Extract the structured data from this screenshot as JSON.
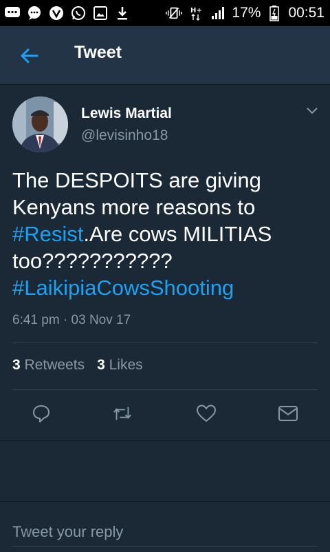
{
  "status_bar": {
    "battery": "17%",
    "time": "00:51",
    "network": "H+"
  },
  "app_bar": {
    "title": "Tweet"
  },
  "tweet": {
    "author_name": "Lewis Martial",
    "author_handle": "@levisinho18",
    "text_part1": "The DESPOITS are giving Kenyans more reasons to ",
    "hashtag1": "#Resist",
    "text_part2": ".Are cows MILITIAS too???????????",
    "hashtag2": "#LaikipiaCowsShooting",
    "timestamp": "6:41 pm · 03 Nov 17",
    "retweets_count": "3",
    "retweets_label": "Retweets",
    "likes_count": "3",
    "likes_label": "Likes"
  },
  "reply": {
    "placeholder": "Tweet your reply"
  },
  "colors": {
    "background": "#1b2836",
    "app_bar": "#243447",
    "accent": "#1da1f2",
    "secondary_text": "#8899a6"
  }
}
